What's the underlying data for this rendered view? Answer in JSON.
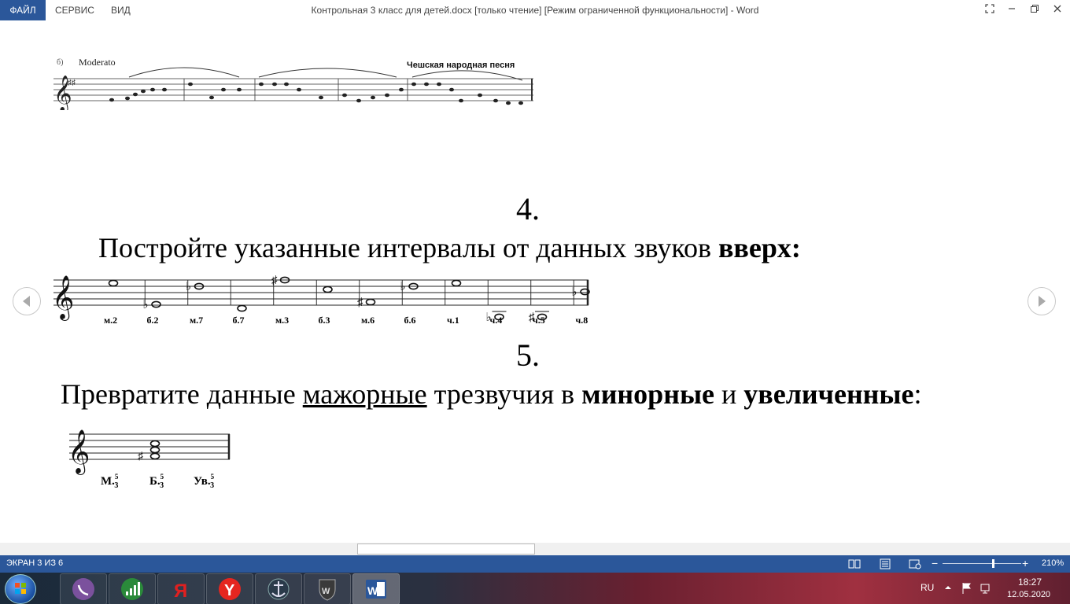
{
  "window": {
    "title": "Контрольная 3 класс для детей.docx [только чтение] [Режим ограниченной функциональности] - Word",
    "menu": [
      "ФАЙЛ",
      "СЕРВИС",
      "ВИД"
    ]
  },
  "doc": {
    "music1": {
      "tempo": "Moderato",
      "number": "б)",
      "caption": "Чешская народная песня"
    },
    "task4": {
      "number": "4.",
      "text": "Постройте указанные интервалы от данных звуков ",
      "bold": "вверх:",
      "intervals": [
        "м.2",
        "б.2",
        "м.7",
        "б.7",
        "м.3",
        "б.3",
        "м.6",
        "б.6",
        "ч.1",
        "ч.4",
        "ч.5",
        "ч.8"
      ]
    },
    "task5": {
      "number": "5.",
      "pre": "Превратите данные ",
      "u": "мажорные",
      "mid": " трезвучия в ",
      "b1": "минорные",
      "and": " и ",
      "b2": "увеличенные",
      "end": ":",
      "chords": [
        {
          "name": "М.",
          "sup": "5",
          "sub": "3"
        },
        {
          "name": "Б.",
          "sup": "5",
          "sub": "3"
        },
        {
          "name": "Ув.",
          "sup": "5",
          "sub": "3"
        }
      ]
    }
  },
  "status": {
    "page": "ЭКРАН 3 ИЗ 6",
    "zoom": "210%",
    "zoom_level_percent": 210
  },
  "taskbar": {
    "lang": "RU",
    "time": "18:27",
    "date": "12.05.2020"
  }
}
